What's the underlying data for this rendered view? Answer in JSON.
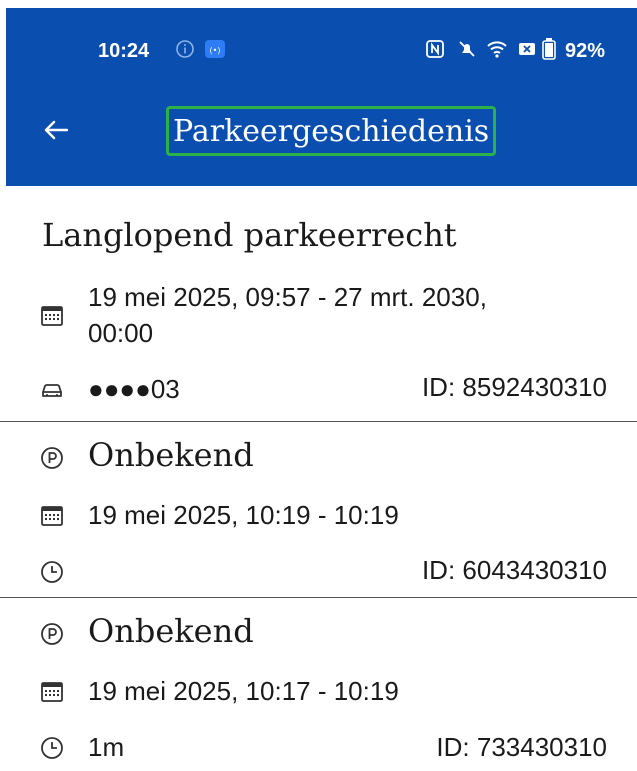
{
  "status_bar": {
    "time": "10:24",
    "battery": "92%"
  },
  "app_bar": {
    "title": "Parkeergeschiedenis"
  },
  "items": [
    {
      "title": "Langlopend parkeerrecht",
      "date_range": "19 mei 2025, 09:57 - 27 mrt. 2030,",
      "date_range_cont": "00:00",
      "plate": "●●●●03",
      "id": "ID: 8592430310"
    },
    {
      "title": "Onbekend",
      "date_range": "19 mei 2025, 10:19 - 10:19",
      "duration": "",
      "id": "ID: 6043430310"
    },
    {
      "title": "Onbekend",
      "date_range": "19 mei 2025, 10:17 - 10:19",
      "duration": "1m",
      "id": "ID: 733430310"
    }
  ],
  "colors": {
    "app_bar": "#0a4fb0",
    "highlight_box": "#2bb34a"
  }
}
